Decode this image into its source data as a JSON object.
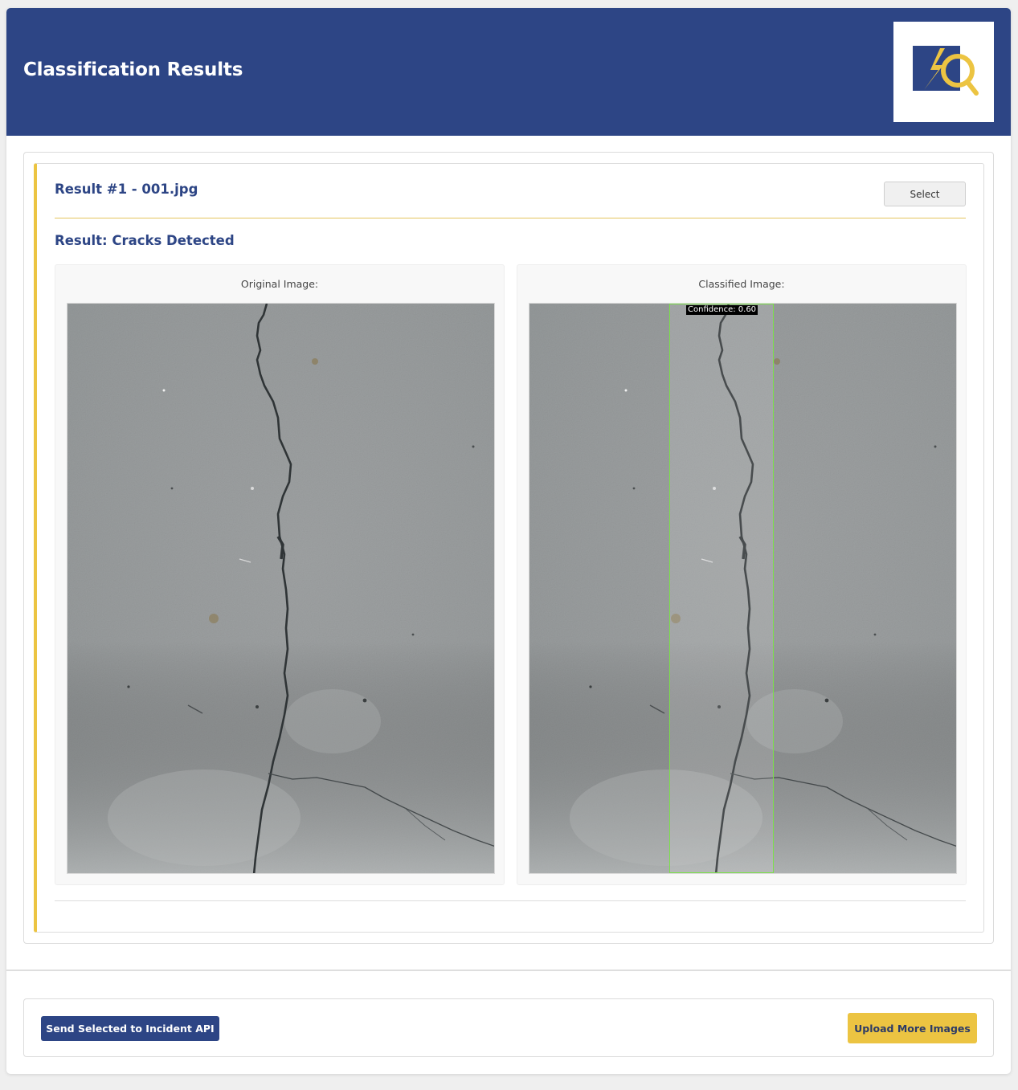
{
  "header": {
    "title": "Classification Results",
    "logo_icon": "magnifier-lightning-logo-icon"
  },
  "colors": {
    "brand_navy": "#2d4585",
    "accent_gold": "#ecc442",
    "detection_box_green": "#7be04a"
  },
  "result": {
    "heading": "Result #1 - 001.jpg",
    "select_label": "Select",
    "status": "Result: Cracks Detected",
    "original_caption": "Original Image:",
    "classified_caption": "Classified Image:",
    "confidence_label": "Confidence: 0.60"
  },
  "actions": {
    "send_label": "Send Selected to Incident API",
    "upload_label": "Upload More Images"
  }
}
